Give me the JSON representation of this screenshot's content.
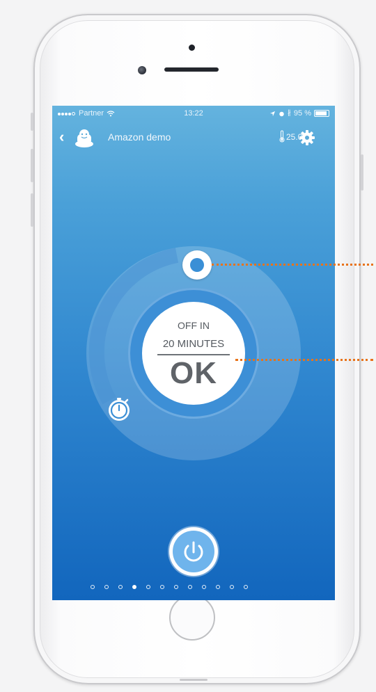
{
  "status_bar": {
    "carrier": "Partner",
    "time": "13:22",
    "battery": "95 %"
  },
  "nav": {
    "title": "Amazon demo",
    "temperature": "25.0°"
  },
  "timer": {
    "line1": "OFF IN",
    "line2": "20 MINUTES",
    "confirm": "OK"
  },
  "pager": {
    "count": 12,
    "active_index": 3
  },
  "colors": {
    "accent": "#3a8fd6",
    "callout": "#e8731a"
  }
}
